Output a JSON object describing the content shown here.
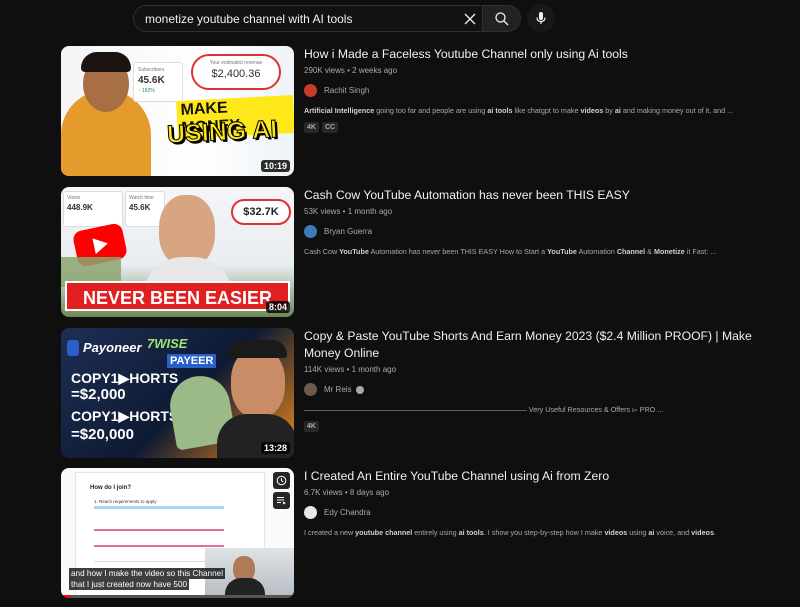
{
  "search": {
    "query": "monetize youtube channel with AI tools",
    "placeholder": "Search"
  },
  "results": [
    {
      "title": "How i Made a Faceless Youtube Channel only using Ai tools",
      "meta": "290K views • 2 weeks ago",
      "channel": "Rachit Singh",
      "description_html": "<b>Artificial Intelligence</b> going too far and people are using <b>ai tools</b> like chatgpt to make <b>videos</b> by <b>ai</b> and making money out of it, and ...",
      "badges": [
        "4K",
        "CC"
      ],
      "duration": "10:19",
      "thumb": {
        "subscribers_label": "Subscribers",
        "subscribers_value": "45.6K",
        "growth": "↑ 192%",
        "revenue_label": "Your estimated revenue",
        "revenue_value": "$2,400.36",
        "headline_1": "MAKE MONEY",
        "headline_2": "USING AI"
      }
    },
    {
      "title": "Cash Cow YouTube Automation has never been THIS EASY",
      "meta": "53K views • 1 month ago",
      "channel": "Bryan Guerra",
      "description_html": "Cash Cow <b>YouTube</b> Automation has never been THIS EASY How to Start a <b>YouTube</b> Automation <b>Channel</b> &amp; <b>Monetize</b> it Fast: ...",
      "badges": [],
      "duration": "8:04",
      "thumb": {
        "views_label": "Views",
        "views_value": "448.9K",
        "watch_label": "Watch time",
        "watch_value": "45.6K",
        "revenue_value": "$32.7K",
        "headline": "NEVER BEEN EASIER"
      }
    },
    {
      "title": "Copy & Paste YouTube Shorts And Earn Money 2023 ($2.4 Million PROOF) | Make Money Online",
      "meta": "114K views • 1 month ago",
      "channel": "Mr Reis",
      "description_html": "——————————————————————————————— Very Useful Resources &amp; Offers ▻ PRO ...",
      "badges": [
        "4K"
      ],
      "duration": "13:28",
      "thumb": {
        "logo_1": "Payoneer",
        "logo_2": "7WISE",
        "logo_3": "PAYEER",
        "line_1": "COPY1▶HORTS",
        "line_2": "=$2,000",
        "line_3": "COPY1▶HORTS",
        "line_4": "=$20,000"
      }
    },
    {
      "title": "I Created An Entire YouTube Channel using Ai from Zero",
      "meta": "6.7K views • 8 days ago",
      "channel": "Edy Chandra",
      "description_html": "I created a new <b>youtube channel</b> entirely using <b>ai tools</b>. I show you step-by-step how I make <b>videos</b> using <b>ai</b> voice, and <b>videos</b>.",
      "badges": [],
      "duration": "",
      "thumb": {
        "doc_heading": "How do I join?",
        "doc_step": "1. Reach requirements to apply",
        "subtitle_1": "and how I make the video so this Channel",
        "subtitle_2": "that I just created now have 500"
      }
    }
  ],
  "colors": {
    "background": "#0f0f0f",
    "text_primary": "#f1f1f1",
    "text_secondary": "#aaaaaa",
    "youtube_red": "#ff0000"
  }
}
